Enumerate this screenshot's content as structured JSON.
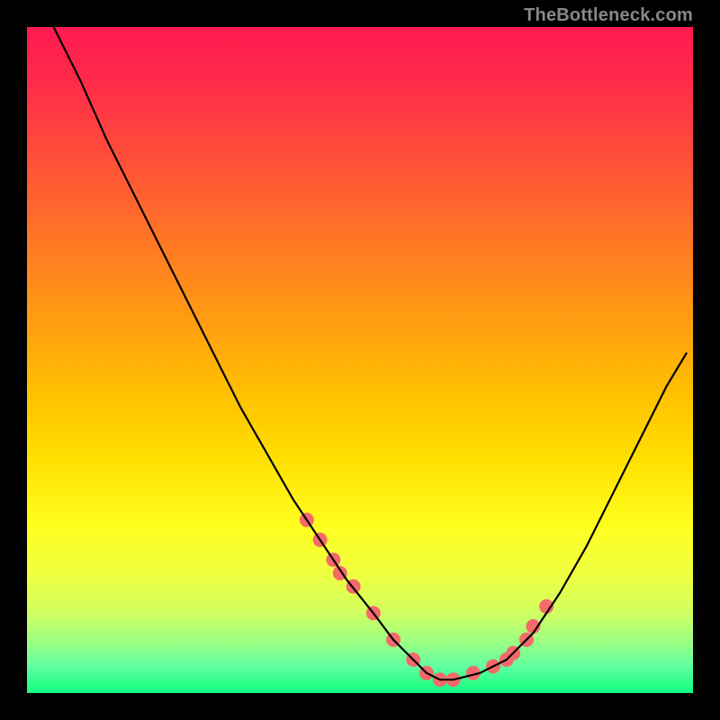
{
  "watermark": "TheBottleneck.com",
  "chart_data": {
    "type": "line",
    "title": "",
    "xlabel": "",
    "ylabel": "",
    "xlim": [
      0,
      100
    ],
    "ylim": [
      0,
      100
    ],
    "background": "rainbow-gradient-vertical",
    "series": [
      {
        "name": "bottleneck-curve",
        "color": "#000000",
        "x": [
          4,
          8,
          12,
          16,
          20,
          24,
          28,
          32,
          36,
          40,
          44,
          48,
          52,
          55,
          58,
          60,
          62,
          64,
          68,
          72,
          76,
          80,
          84,
          88,
          92,
          96,
          99
        ],
        "y": [
          100,
          92,
          83,
          75,
          67,
          59,
          51,
          43,
          36,
          29,
          23,
          17,
          12,
          8,
          5,
          3,
          2,
          2,
          3,
          5,
          9,
          15,
          22,
          30,
          38,
          46,
          51
        ]
      }
    ],
    "markers": [
      {
        "name": "highlight-dots",
        "color": "#f46a6a",
        "radius_px": 8,
        "x": [
          42,
          44,
          46,
          47,
          49,
          52,
          55,
          58,
          60,
          62,
          64,
          67,
          70,
          72,
          73,
          75,
          76,
          78
        ],
        "y": [
          26,
          23,
          20,
          18,
          16,
          12,
          8,
          5,
          3,
          2,
          2,
          3,
          4,
          5,
          6,
          8,
          10,
          13
        ]
      }
    ]
  }
}
